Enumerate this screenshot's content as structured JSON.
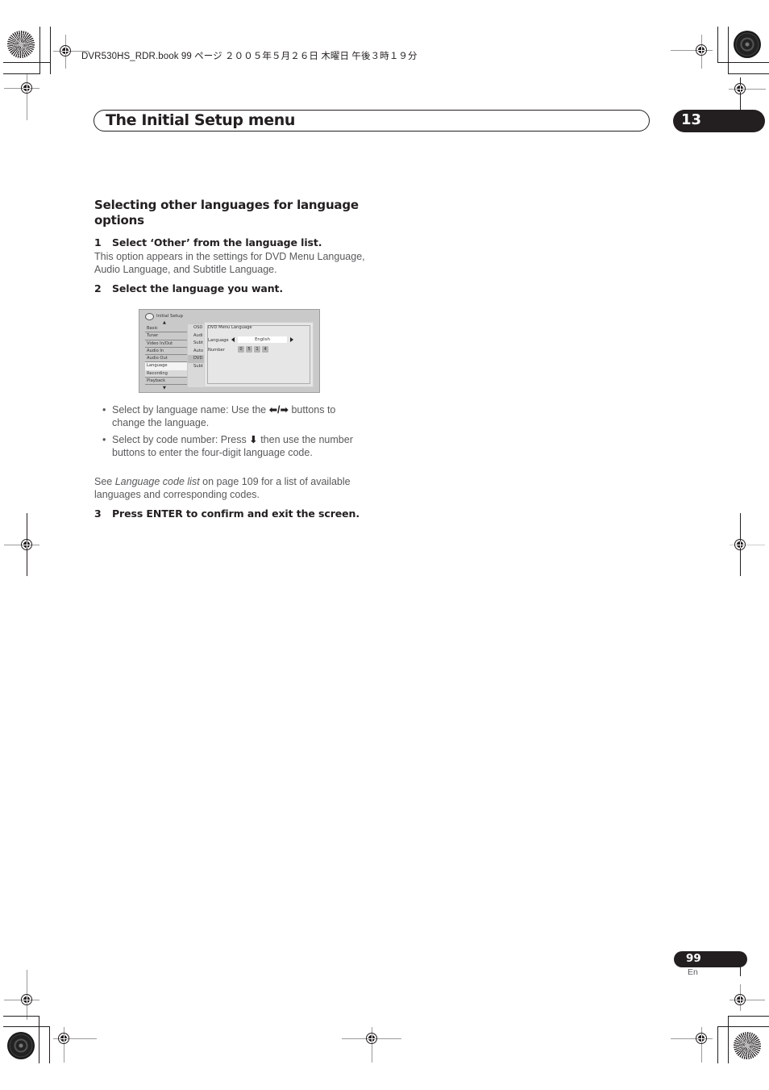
{
  "print_job_line": "DVR530HS_RDR.book  99 ページ  ２００５年５月２６日  木曜日  午後３時１９分",
  "header": {
    "chapter_title": "The Initial Setup menu",
    "chapter_number": "13"
  },
  "section": {
    "heading": "Selecting other languages for language options",
    "steps": [
      {
        "number": "1",
        "text": "Select ‘Other’ from the language list."
      },
      {
        "number": "2",
        "text": "Select the language you want."
      },
      {
        "number": "3",
        "text": "Press ENTER to confirm and exit the screen."
      }
    ],
    "step1_body": "This option appears in the settings for DVD Menu Language, Audio Language, and Subtitle Language.",
    "bullets": [
      {
        "before": "Select by language name: Use the ",
        "glyph": "⬅/➡",
        "after": " buttons to change the language."
      },
      {
        "before": "Select by code number: Press ",
        "glyph": "⬇",
        "after": " then use the number buttons to enter the four-digit language code."
      }
    ],
    "see_also": {
      "prefix": "See ",
      "link_text": "Language code list",
      "suffix": " on page 109 for a list of available languages and corresponding codes."
    }
  },
  "osd_screen": {
    "title": "Initial Setup",
    "menu_items": [
      "Basic",
      "Tuner",
      "Video In/Out",
      "Audio In",
      "Audio Out",
      "Language",
      "Recording",
      "Playback"
    ],
    "selected_menu_item": "Language",
    "submenu_items": [
      "OSD",
      "Audi",
      "Subt",
      "Auto",
      "DVD",
      "Subt"
    ],
    "highlighted_submenu_item": "DVD",
    "panel_title": "DVD Menu Language",
    "language_label": "Language",
    "language_value": "English",
    "number_label": "Number",
    "code_digits": [
      "0",
      "5",
      "1",
      "4"
    ]
  },
  "footer": {
    "page_number": "99",
    "language_code": "En"
  }
}
